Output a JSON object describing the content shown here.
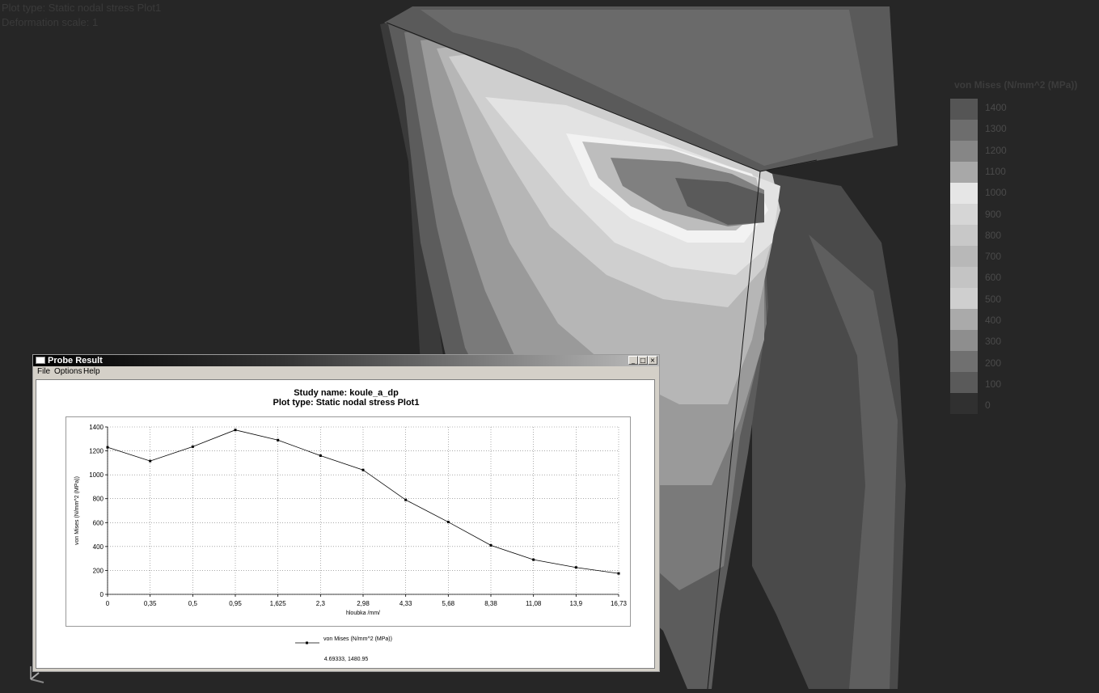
{
  "viewport": {
    "plot_type_text": "Plot type: Static nodal stress Plot1",
    "deformation_text": "Deformation scale: 1",
    "legend_title": "von Mises (N/mm^2 (MPa))",
    "legend_labels": [
      "1400",
      "1300",
      "1200",
      "1100",
      "1000",
      "900",
      "800",
      "700",
      "600",
      "500",
      "400",
      "300",
      "200",
      "100",
      "0"
    ],
    "legend_colors": [
      "#555555",
      "#6d6d6d",
      "#868686",
      "#a8a8a8",
      "#e6e6e6",
      "#d6d6d6",
      "#c8c8c8",
      "#b8b8b8",
      "#c4c4c4",
      "#cfcfcf",
      "#aaaaaa",
      "#8e8e8e",
      "#707070",
      "#5a5a5a",
      "#303030"
    ]
  },
  "probe_window": {
    "title": "Probe Result",
    "menu": [
      "File",
      "Options",
      "Help"
    ],
    "minimize_label": "_",
    "maximize_label": "□",
    "close_label": "×",
    "chart_title": "Study name: koule_a_dp",
    "chart_subtitle": "Plot type: Static nodal stress Plot1",
    "legend_entry": "von Mises (N/mm^2 (MPa))",
    "coordinate_readout": "4.69333, 1480.95"
  },
  "chart_data": {
    "type": "line",
    "title": "Study name: koule_a_dp",
    "subtitle": "Plot type: Static nodal stress Plot1",
    "xlabel": "hloubka /mm/",
    "ylabel": "von Mises (N/mm^2 (MPa))",
    "categories": [
      "0",
      "0,35",
      "0,5",
      "0,95",
      "1,625",
      "2,3",
      "2,98",
      "4,33",
      "5,68",
      "8,38",
      "11,08",
      "13,9",
      "16,73"
    ],
    "series": [
      {
        "name": "von Mises (N/mm^2 (MPa))",
        "values": [
          1230,
          1115,
          1235,
          1375,
          1290,
          1160,
          1040,
          790,
          605,
          410,
          290,
          225,
          175
        ]
      }
    ],
    "ylim": [
      0,
      1400
    ],
    "yticks": [
      0,
      200,
      400,
      600,
      800,
      1000,
      1200,
      1400
    ],
    "grid": true,
    "legend_placement": "bottom"
  }
}
